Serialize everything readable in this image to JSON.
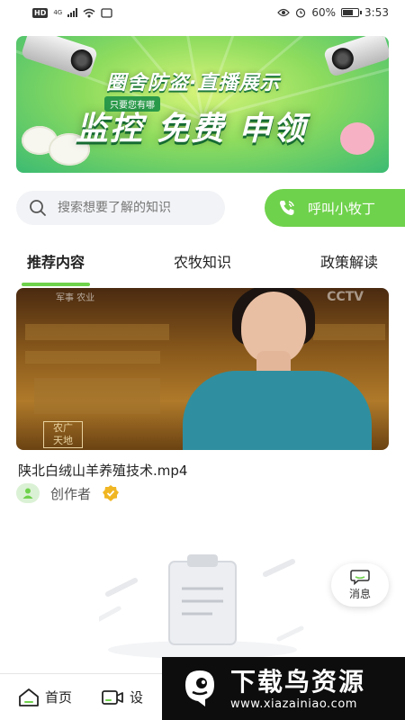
{
  "status_bar": {
    "hd": "HD",
    "net": "4G",
    "battery_text": "60%",
    "time": "3:53",
    "battery_level": 0.6
  },
  "banner": {
    "title": "圈舍防盗·直播展示",
    "subtitle": "只要您有哪",
    "headline": "监控 免费 申领"
  },
  "search": {
    "placeholder": "搜索想要了解的知识"
  },
  "call_button": {
    "label": "呼叫小牧丁",
    "color": "#6fd24c"
  },
  "tabs": [
    {
      "label": "推荐内容",
      "active": true
    },
    {
      "label": "农牧知识",
      "active": false
    },
    {
      "label": "政策解读",
      "active": false
    }
  ],
  "video": {
    "title": "陕北白绒山羊养殖技术.mp4",
    "author": "创作者",
    "overlay_logo": "农广\n天地",
    "overlay_top": "军事 农业",
    "overlay_channel": "CCTV"
  },
  "floating": {
    "message_label": "消息"
  },
  "bottom_nav": {
    "home": "首页",
    "second": "设"
  },
  "watermark": {
    "title": "下载鸟资源",
    "url": "www.xiazainiao.com"
  },
  "colors": {
    "accent": "#6fd24c",
    "tab_underline": "#6fd24c"
  }
}
